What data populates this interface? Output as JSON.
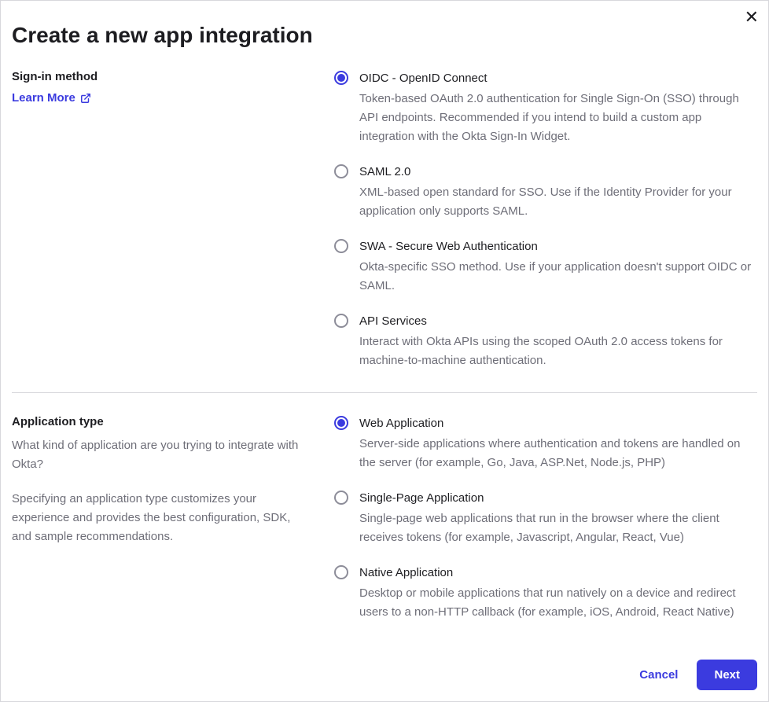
{
  "modal": {
    "title": "Create a new app integration",
    "close_aria": "Close"
  },
  "sections": {
    "sign_in": {
      "heading": "Sign-in method",
      "learn_more": "Learn More",
      "options": [
        {
          "title": "OIDC - OpenID Connect",
          "desc": "Token-based OAuth 2.0 authentication for Single Sign-On (SSO) through API endpoints. Recommended if you intend to build a custom app integration with the Okta Sign-In Widget.",
          "selected": true
        },
        {
          "title": "SAML 2.0",
          "desc": "XML-based open standard for SSO. Use if the Identity Provider for your application only supports SAML.",
          "selected": false
        },
        {
          "title": "SWA - Secure Web Authentication",
          "desc": "Okta-specific SSO method. Use if your application doesn't support OIDC or SAML.",
          "selected": false
        },
        {
          "title": "API Services",
          "desc": "Interact with Okta APIs using the scoped OAuth 2.0 access tokens for machine-to-machine authentication.",
          "selected": false
        }
      ]
    },
    "app_type": {
      "heading": "Application type",
      "sub1": "What kind of application are you trying to integrate with Okta?",
      "sub2": "Specifying an application type customizes your experience and provides the best configuration, SDK, and sample recommendations.",
      "options": [
        {
          "title": "Web Application",
          "desc": "Server-side applications where authentication and tokens are handled on the server (for example, Go, Java, ASP.Net, Node.js, PHP)",
          "selected": true
        },
        {
          "title": "Single-Page Application",
          "desc": "Single-page web applications that run in the browser where the client receives tokens (for example, Javascript, Angular, React, Vue)",
          "selected": false
        },
        {
          "title": "Native Application",
          "desc": "Desktop or mobile applications that run natively on a device and redirect users to a non-HTTP callback (for example, iOS, Android, React Native)",
          "selected": false
        }
      ]
    }
  },
  "footer": {
    "cancel": "Cancel",
    "next": "Next"
  }
}
